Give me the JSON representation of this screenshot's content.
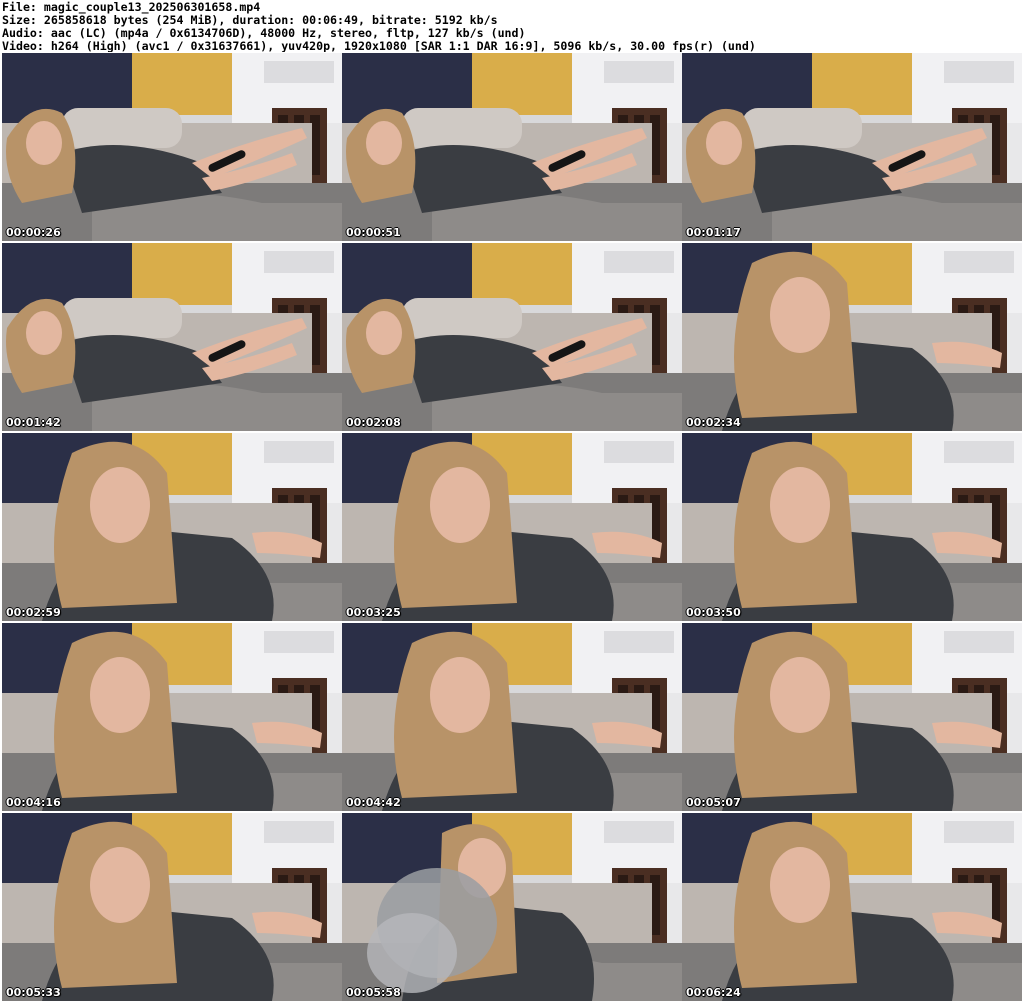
{
  "header": {
    "file_line": "File: magic_couple13_202506301658.mp4",
    "size_line": "Size: 265858618 bytes (254 MiB), duration: 00:06:49, bitrate: 5192 kb/s",
    "audio_line": "Audio: aac (LC) (mp4a / 0x6134706D), 48000 Hz, stereo, fltp, 127 kb/s (und)",
    "video_line": "Video: h264 (High) (avc1 / 0x31637661), yuv420p, 1920x1080 [SAR 1:1 DAR 16:9], 5096 kb/s, 30.00 fps(r) (und)"
  },
  "colors": {
    "wall_yellow": "#d9ad4a",
    "curtain_navy": "#2b2f47",
    "sofa_grey": "#bdb6b0",
    "jacket_dark": "#3a3d42",
    "hair_blonde": "#b89368",
    "skin": "#e3b7a0",
    "blanket_grey": "#7d7b7a",
    "kitchen_white": "#e8e8ea"
  },
  "thumbnails": [
    {
      "time": "00:00:26",
      "pose": "lying"
    },
    {
      "time": "00:00:51",
      "pose": "lying"
    },
    {
      "time": "00:01:17",
      "pose": "lying"
    },
    {
      "time": "00:01:42",
      "pose": "lying"
    },
    {
      "time": "00:02:08",
      "pose": "lying"
    },
    {
      "time": "00:02:34",
      "pose": "close"
    },
    {
      "time": "00:02:59",
      "pose": "close"
    },
    {
      "time": "00:03:25",
      "pose": "close"
    },
    {
      "time": "00:03:50",
      "pose": "close"
    },
    {
      "time": "00:04:16",
      "pose": "close"
    },
    {
      "time": "00:04:42",
      "pose": "close"
    },
    {
      "time": "00:05:07",
      "pose": "close"
    },
    {
      "time": "00:05:33",
      "pose": "close"
    },
    {
      "time": "00:05:58",
      "pose": "smoke"
    },
    {
      "time": "00:06:24",
      "pose": "close"
    }
  ]
}
